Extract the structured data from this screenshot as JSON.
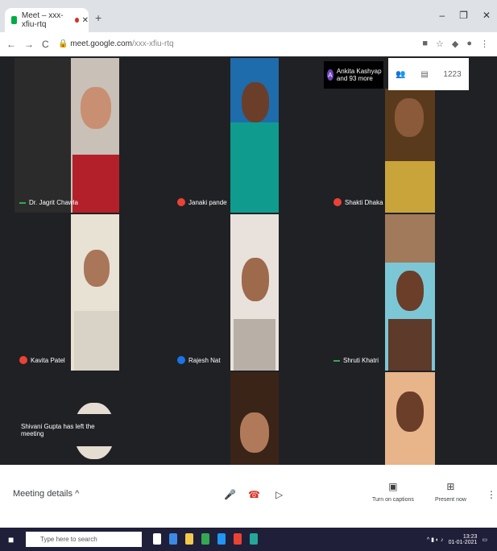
{
  "browser": {
    "tab_title": "Meet – xxx-xfiu-rtq",
    "new_tab": "+",
    "url_host": "meet.google.com",
    "url_path": "/xxx-xfiu-rtq",
    "window_controls": [
      "–",
      "❐",
      "✕"
    ],
    "nav": [
      "←",
      "→",
      "C"
    ]
  },
  "meeting": {
    "top_card": {
      "avatar_letter": "A",
      "text": "Ankita Kashyap and 93 more"
    },
    "people_count": "1223",
    "participants": [
      {
        "name": "Dr. Jagrit Chawla",
        "mic": "on"
      },
      {
        "name": "Janaki pandey",
        "mic": "off"
      },
      {
        "name": "Shakti Dhakar",
        "mic": "off"
      },
      {
        "name": "Kavita Patel",
        "mic": "off"
      },
      {
        "name": "Rajesh Nat",
        "mic": "active"
      },
      {
        "name": "Shruti Khatri",
        "mic": "on"
      }
    ],
    "toast": "Shivani Gupta has left the meeting"
  },
  "controls": {
    "meeting_details": "Meeting details",
    "turn_on_captions": "Turn on captions",
    "present_now": "Present now"
  },
  "taskbar": {
    "search_placeholder": "Type here to search",
    "time": "13:23",
    "date": "01-01-2021"
  }
}
